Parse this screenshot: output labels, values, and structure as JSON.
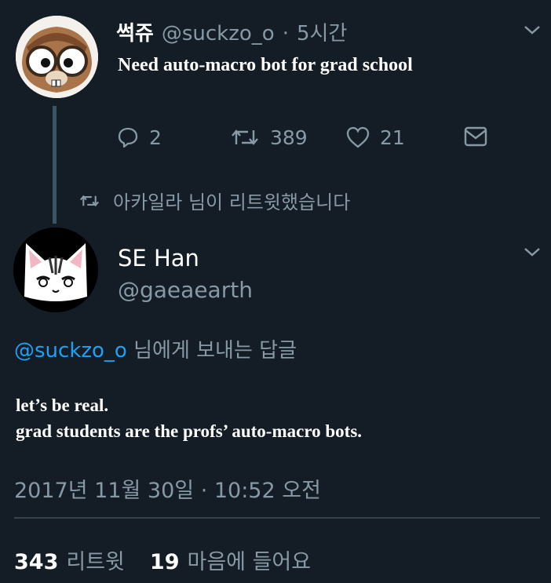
{
  "original_tweet": {
    "display_name": "썩쥬",
    "handle": "@suckzo_o",
    "separator": "·",
    "time": "5시간",
    "text": "Need auto-macro bot for grad school",
    "replies": "2",
    "retweets": "389",
    "likes": "21"
  },
  "retweet_notice": {
    "text": "아카일라 님이 리트윗했습니다"
  },
  "reply_tweet": {
    "display_name": "SE Han",
    "handle": "@gaeaearth",
    "reply_to_handle": "@suckzo_o",
    "reply_to_suffix": "님에게 보내는 답글",
    "text_line1": "let’s be real.",
    "text_line2": "grad students are the profs’ auto-macro bots.",
    "timestamp": "2017년 11월 30일 · 10:52 오전",
    "retweet_count": "343",
    "retweet_label": "리트윗",
    "like_count": "19",
    "like_label": "마음에 들어요"
  },
  "colors": {
    "background": "#141d26",
    "muted": "#8899a6",
    "link": "#1da1f2",
    "text": "#ffffff"
  }
}
